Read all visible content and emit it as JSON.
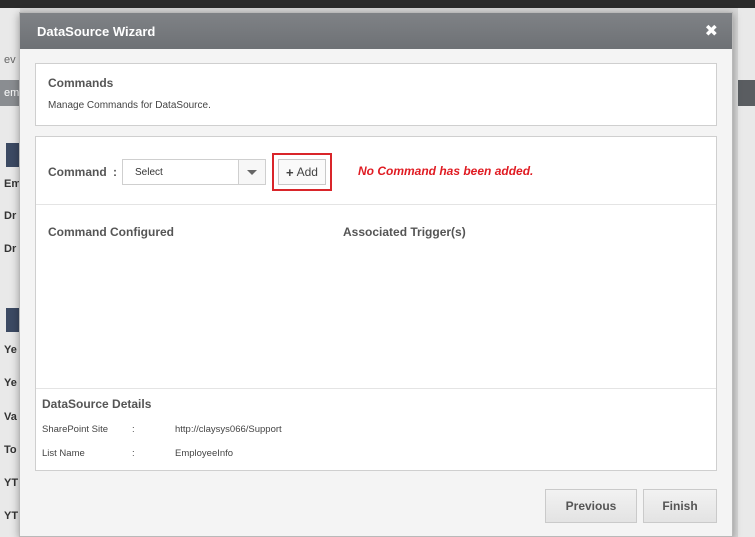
{
  "background": {
    "fragments": [
      "ev",
      "em",
      "Em",
      "Dr",
      "Dr",
      "Ye",
      "Ye",
      "Va",
      "To",
      "YT",
      "YT"
    ]
  },
  "dialog": {
    "title": "DataSource Wizard",
    "close_glyph": "✖",
    "commands_panel": {
      "title": "Commands",
      "description": "Manage Commands for DataSource."
    },
    "command_row": {
      "label": "Command",
      "colon": ":",
      "select_value": "Select",
      "add_plus": "+",
      "add_label": "Add",
      "message": "No Command has been added."
    },
    "table": {
      "col_configured": "Command Configured",
      "col_triggers": "Associated Trigger(s)"
    },
    "datasource_details": {
      "title": "DataSource Details",
      "rows": [
        {
          "label": "SharePoint Site",
          "colon": ":",
          "value": "http://claysys066/Support"
        },
        {
          "label": "List Name",
          "colon": ":",
          "value": "EmployeeInfo"
        }
      ]
    },
    "footer": {
      "previous_label": "Previous",
      "finish_label": "Finish"
    }
  },
  "colors": {
    "header_bg": "#75787c",
    "highlight_border": "#d9252a",
    "error_text": "#e01b22"
  }
}
